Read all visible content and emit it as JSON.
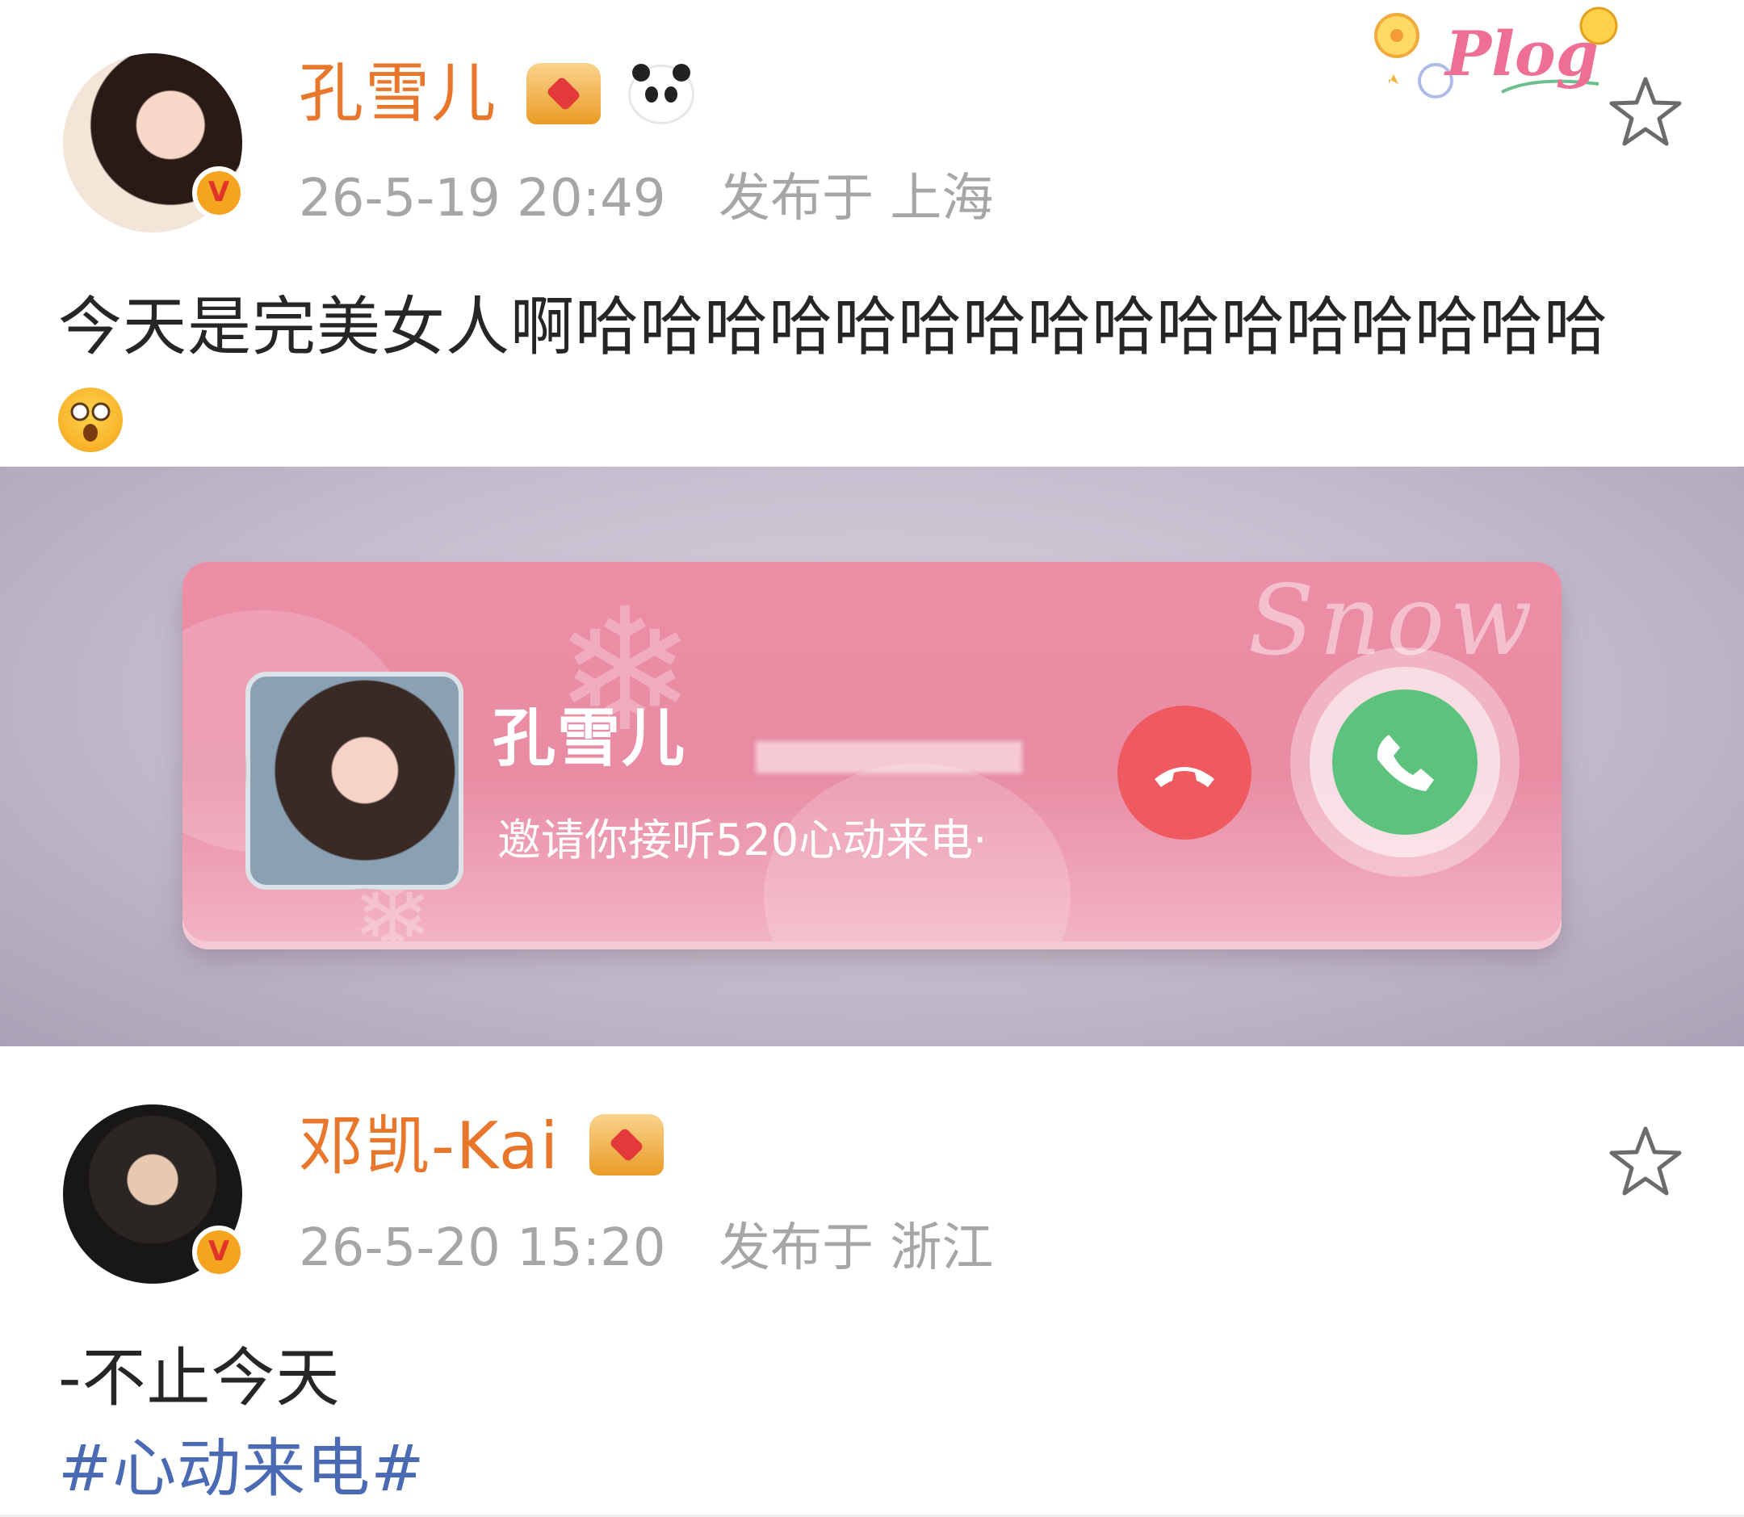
{
  "post1": {
    "author": "孔雪儿",
    "timestamp": "26-5-19 20:49",
    "location": "发布于 上海",
    "text": "今天是完美女人啊哈哈哈哈哈哈哈哈哈哈哈哈哈哈哈哈",
    "emoji": "shock-emoji",
    "badge": "V",
    "sticker": "Plog",
    "media": {
      "caller_name": "孔雪儿",
      "caller_subtitle": "邀请你接听520心动来电·",
      "watermark": "Snow"
    }
  },
  "post2": {
    "author": "邓凯-Kai",
    "timestamp": "26-5-20 15:20",
    "location": "发布于 浙江",
    "text": "-不止今天",
    "hashtag": "#心动来电#",
    "badge": "V"
  },
  "colors": {
    "name": "#e8762b",
    "meta": "#a6a6a6",
    "hashtag": "#4a6ab4",
    "decline": "#ee5a5f",
    "accept": "#5cc27e",
    "card": "#e88ba3"
  }
}
